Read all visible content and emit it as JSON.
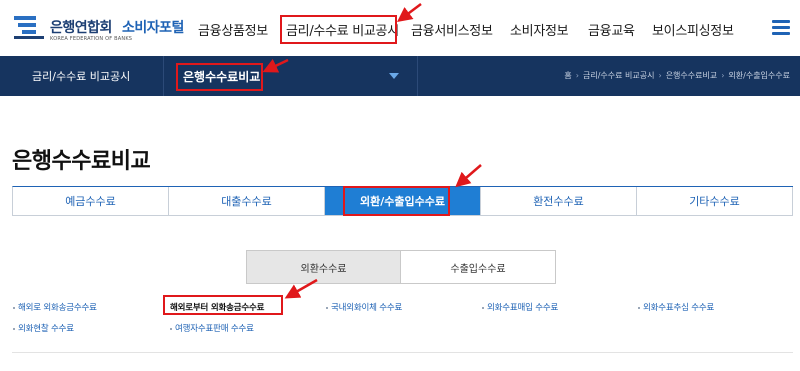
{
  "header": {
    "logo_org": "은행연합회",
    "logo_sub": "KOREA FEDERATION OF BANKS",
    "logo_portal": "소비자포털",
    "gnb": [
      {
        "label": "금융상품정보"
      },
      {
        "label": "금리/수수료 비교공시"
      },
      {
        "label": "금융서비스정보"
      },
      {
        "label": "소비자정보"
      },
      {
        "label": "금융교육"
      },
      {
        "label": "보이스피싱정보"
      }
    ],
    "menu_icon": "hamburger-menu-icon"
  },
  "subbar": {
    "category": "금리/수수료 비교공시",
    "current": "은행수수료비교",
    "breadcrumb": [
      "홈",
      "금리/수수료 비교공시",
      "은행수수료비교",
      "외환/수출입수수료"
    ]
  },
  "page": {
    "title": "은행수수료비교",
    "tabs": [
      {
        "label": "예금수수료"
      },
      {
        "label": "대출수수료"
      },
      {
        "label": "외환/수출입수수료"
      },
      {
        "label": "환전수수료"
      },
      {
        "label": "기타수수료"
      }
    ],
    "active_tab": "외환/수출입수수료",
    "toggle": [
      {
        "label": "외환수수료"
      },
      {
        "label": "수출입수수료"
      }
    ],
    "fee_links": [
      {
        "label": "해외로 외화송금수수료"
      },
      {
        "label": "해외로부터 외화송금수수료"
      },
      {
        "label": "국내외화이체 수수료"
      },
      {
        "label": "외화수표매입 수수료"
      },
      {
        "label": "외화수표추심 수수료"
      },
      {
        "label": "외화현찰 수수료"
      },
      {
        "label": "여행자수표판매 수수료"
      }
    ]
  },
  "colors": {
    "navy": "#16345f",
    "brand_blue": "#1f63b5",
    "active_tab": "#1f7ed4",
    "annotation_red": "#e0181b"
  }
}
